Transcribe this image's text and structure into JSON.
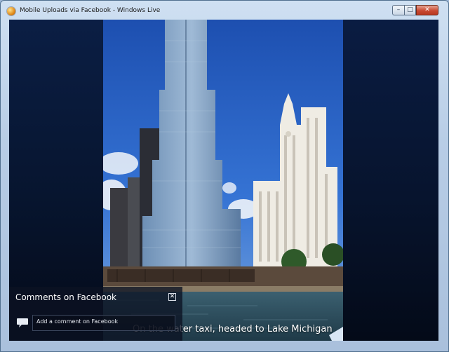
{
  "window": {
    "title": "Mobile Uploads via Facebook - Windows Live",
    "controls": {
      "minimize": "–",
      "maximize": "□",
      "close": "✕"
    }
  },
  "photo": {
    "caption": "On the water taxi, headed to Lake Michigan"
  },
  "comments": {
    "title": "Comments on Facebook",
    "close": "✕",
    "placeholder": "Add a comment on Facebook"
  },
  "icons": {
    "app": "windows-live-photo-icon",
    "comment": "speech-bubble-icon"
  },
  "colors": {
    "panel_bg": "#07152f",
    "sky": "#2a63c8",
    "water": "#2e5060"
  }
}
